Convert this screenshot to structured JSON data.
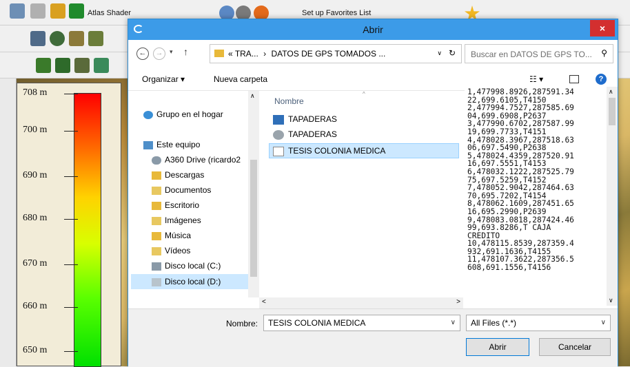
{
  "app": {
    "toolbar1": {
      "atlas_label": "Atlas Shader",
      "favorites_label": "Set up Favorites List"
    },
    "legend": {
      "ticks": [
        "708 m",
        "700 m",
        "690 m",
        "680 m",
        "670 m",
        "660 m",
        "650 m"
      ]
    }
  },
  "dialog": {
    "title": "Abrir",
    "close_label": "×",
    "breadcrumb": {
      "parts": [
        "«",
        "TRA...",
        "›",
        "DATOS DE GPS TOMADOS ..."
      ]
    },
    "search_placeholder": "Buscar en DATOS DE GPS TO...",
    "organize_label": "Organizar ▾",
    "new_folder_label": "Nueva carpeta",
    "nav": {
      "items": [
        {
          "label": "Grupo en el hogar",
          "icon": "homegroup-icon"
        },
        {
          "label": "Este equipo",
          "icon": "computer-icon"
        },
        {
          "label": "A360 Drive (ricardo2",
          "icon": "cloud-drive-icon"
        },
        {
          "label": "Descargas",
          "icon": "downloads-folder-icon"
        },
        {
          "label": "Documentos",
          "icon": "documents-folder-icon"
        },
        {
          "label": "Escritorio",
          "icon": "desktop-folder-icon"
        },
        {
          "label": "Imágenes",
          "icon": "pictures-folder-icon"
        },
        {
          "label": "Música",
          "icon": "music-folder-icon"
        },
        {
          "label": "Vídeos",
          "icon": "videos-folder-icon"
        },
        {
          "label": "Disco local (C:)",
          "icon": "drive-c-icon"
        },
        {
          "label": "Disco local (D:)",
          "icon": "drive-d-icon",
          "selected": true
        }
      ]
    },
    "file_list": {
      "column_header": "Nombre",
      "files": [
        {
          "name": "TAPADERAS",
          "icon": "app-file-icon"
        },
        {
          "name": "TAPADERAS",
          "icon": "cad-file-icon"
        },
        {
          "name": "TESIS COLONIA MEDICA",
          "icon": "text-file-icon",
          "selected": true
        }
      ]
    },
    "preview_lines": [
      "1,477998.8926,287591.34",
      "22,699.6105,T4150",
      "2,477994.7527,287585.69",
      "04,699.6908,P2637",
      "3,477990.6702,287587.99",
      "19,699.7733,T4151",
      "4,478028.3967,287518.63",
      "06,697.5490,P2638",
      "5,478024.4359,287520.91",
      "16,697.5551,T4153",
      "6,478032.1222,287525.79",
      "75,697.5259,T4152",
      "7,478052.9042,287464.63",
      "70,695.7202,T4154",
      "8,478062.1609,287451.65",
      "16,695.2990,P2639",
      "9,478083.0818,287424.46",
      "99,693.8286,T CAJA",
      "CREDITO",
      "10,478115.8539,287359.4",
      "932,691.1636,T4155",
      "11,478107.3622,287356.5",
      "608,691.1556,T4156"
    ],
    "filename_label": "Nombre:",
    "filename_value": "TESIS COLONIA MEDICA",
    "filetype_value": "All Files (*.*)",
    "open_label": "Abrir",
    "cancel_label": "Cancelar"
  }
}
